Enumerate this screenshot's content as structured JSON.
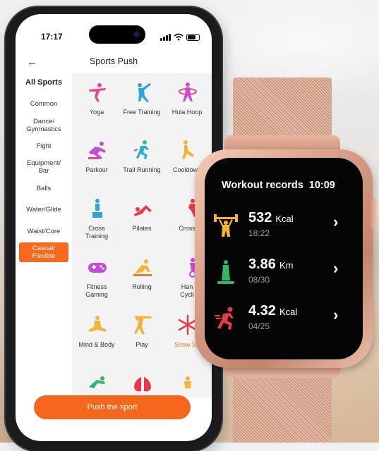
{
  "phone": {
    "status_time": "17:17",
    "title": "Sports Push",
    "back_icon": "arrow-left-icon",
    "categories": [
      {
        "label": "All Sports",
        "active": false
      },
      {
        "label": "Common",
        "active": false
      },
      {
        "label": "Dance/\nGymnastics",
        "active": false
      },
      {
        "label": "Fight",
        "active": false
      },
      {
        "label": "Equipment/\nBar",
        "active": false
      },
      {
        "label": "Balls",
        "active": false
      },
      {
        "label": "Water/Glide",
        "active": false
      },
      {
        "label": "Waist/Core",
        "active": false
      },
      {
        "label": "Casual/\nFlexible",
        "active": true
      }
    ],
    "sports": [
      {
        "label": "Yoga",
        "icon": "yoga-icon",
        "color": "#e5459a"
      },
      {
        "label": "Free Training",
        "icon": "free-training-icon",
        "color": "#2aa6d8"
      },
      {
        "label": "Hula Hoop",
        "icon": "hula-hoop-icon",
        "color": "#c44fd6"
      },
      {
        "label": "Parkour",
        "icon": "parkour-icon",
        "color": "#c04fd6"
      },
      {
        "label": "Trail Running",
        "icon": "trail-running-icon",
        "color": "#2ab0c8"
      },
      {
        "label": "Cooldown",
        "icon": "cooldown-icon",
        "color": "#f3b33a"
      },
      {
        "label": "Cross\nTraining",
        "icon": "cross-training-icon",
        "color": "#2aa6d8"
      },
      {
        "label": "Pilates",
        "icon": "pilates-icon",
        "color": "#e8394a"
      },
      {
        "label": "Cross",
        "icon": "cross-icon",
        "color": "#e8394a"
      },
      {
        "label": "Fitness\nGaming",
        "icon": "gamepad-icon",
        "color": "#c44fd6"
      },
      {
        "label": "Rolling",
        "icon": "rolling-icon",
        "color": "#f3b33a"
      },
      {
        "label": "Han\nCycli",
        "icon": "hand-cycling-icon",
        "color": "#c44fd6"
      },
      {
        "label": "Mind & Body",
        "icon": "mind-body-icon",
        "color": "#f3b33a"
      },
      {
        "label": "Play",
        "icon": "play-icon",
        "color": "#f3b33a"
      },
      {
        "label": "Snow Sp",
        "icon": "snowflake-icon",
        "color": "#e8394a",
        "highlight": true
      },
      {
        "label": "",
        "icon": "stretch-icon",
        "color": "#2bb673"
      },
      {
        "label": "",
        "icon": "lungs-icon",
        "color": "#e8394a"
      },
      {
        "label": "",
        "icon": "kids-icon",
        "color": "#f3b33a"
      }
    ],
    "push_button": "Push the sport",
    "accent": "#f4671d"
  },
  "watch": {
    "header": "Workout records",
    "time": "10:09",
    "records": [
      {
        "icon": "weightlifting-icon",
        "icon_color": "#f2b732",
        "value": "532",
        "unit": "Kcal",
        "date": "18:22"
      },
      {
        "icon": "elliptical-icon",
        "icon_color": "#31b56b",
        "value": "3.86",
        "unit": "Km",
        "date": "08/30"
      },
      {
        "icon": "running-icon",
        "icon_color": "#e8394a",
        "value": "4.32",
        "unit": "Kcal",
        "date": "04/25"
      }
    ]
  }
}
